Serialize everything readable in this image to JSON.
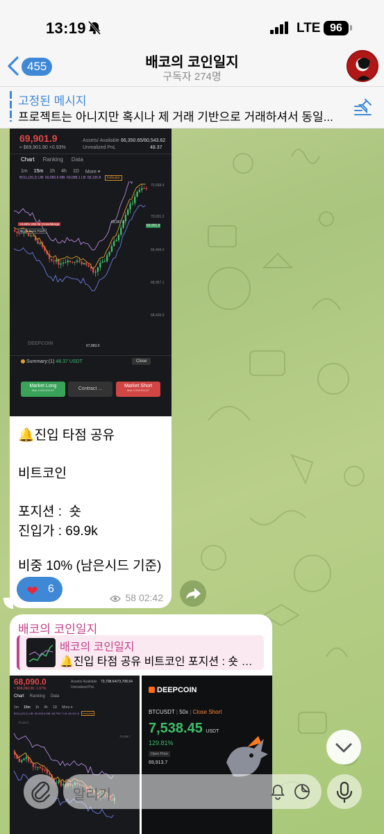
{
  "status_bar": {
    "time": "13:19",
    "network": "LTE",
    "battery": "96"
  },
  "header": {
    "back_count": "455",
    "title": "배코의 코인일지",
    "subtitle": "구독자 274명"
  },
  "pinned": {
    "title": "고정된 메시지",
    "text": "프로젝트는 아니지만 혹시나 제 거래 기반으로 거래하셔서 동일..."
  },
  "message1": {
    "screenshot": {
      "price": "69,901.9",
      "price_sub": "≈ $69,901.90 +0.93%",
      "assets_label": "Assets/ Available",
      "assets_value": "66,350.65/60,543.62",
      "pnl_label": "Unrealized PnL",
      "pnl_value": "48.37",
      "tabs": [
        "Chart",
        "Ranking",
        "Data"
      ],
      "intervals": [
        "1m",
        "15m",
        "1h",
        "4h",
        "1D",
        "More ▾"
      ],
      "boll": "BOLL(20,2)  UB: 69,980.6  MB: 69,088.1  LB: 68,195.8",
      "indicator": "Indicator",
      "y_ticks": [
        "70,568.4",
        "70,031.3",
        "69,494.2",
        "68,957.1",
        "68,420.0"
      ],
      "high_label": "69,957.9",
      "last_label": "69,901.9",
      "low_label": "67,883.0",
      "cross_label": "+0.83%  290.36 Cross/Merge",
      "break_even": "Break Even Price",
      "watermark": "DEEPCOIN",
      "summary_label": "Summary:(1)",
      "summary_value": "48.37 USDT",
      "close_btn": "Close",
      "market_long": "Market Long",
      "market_long_sub": "Max 2,939,910.67",
      "contract_btn": "Contract ...",
      "market_short": "Market Short",
      "market_short_sub": "Max 2,939,910.67"
    },
    "line1": "🔔진입 타점 공유",
    "line2": "비트코인",
    "line3": "포지션 :  숏",
    "line4": "진입가 : 69.9k",
    "line5": "비중 10% (남은시드 기준)",
    "reaction_count": "6",
    "views": "58",
    "time": "02:42"
  },
  "message2": {
    "sender": "배코의 코인일지",
    "reply_name": "배코의 코인일지",
    "reply_text": "🔔진입 타점 공유 비트코인 포지션 : 숏 진입가 : 69.9k",
    "shot_a": {
      "price": "68,090.0",
      "price_sub": "≈ $68,090.00 -1.67%",
      "assets_label": "Assets/ Available",
      "assets_value": "73,708.64/73,708.64",
      "pnl_label": "Unrealized PnL",
      "tabs": [
        "Chart",
        "Ranking",
        "Data"
      ],
      "intervals": [
        "1m",
        "15m",
        "1h",
        "4h",
        "1D",
        "More ▾"
      ],
      "boll": "BOLL(20,2)  UB: 69,006.6  MB: 68,795.7  LB: 68,101.8",
      "indicator": "Indicator",
      "y_ticks": [
        "70,424.2",
        "70,028.7"
      ]
    },
    "shot_b": {
      "brand": "DEEPCOIN",
      "pair": "BTCUSDT",
      "leverage": "50x",
      "action": "Close Short",
      "pnl": "7,538.45",
      "pnl_unit": "USDT",
      "roi": "129.81%",
      "open_price_label": "Open Price",
      "open_price": "69,913.7"
    }
  },
  "composer": {
    "placeholder": "알리기"
  }
}
